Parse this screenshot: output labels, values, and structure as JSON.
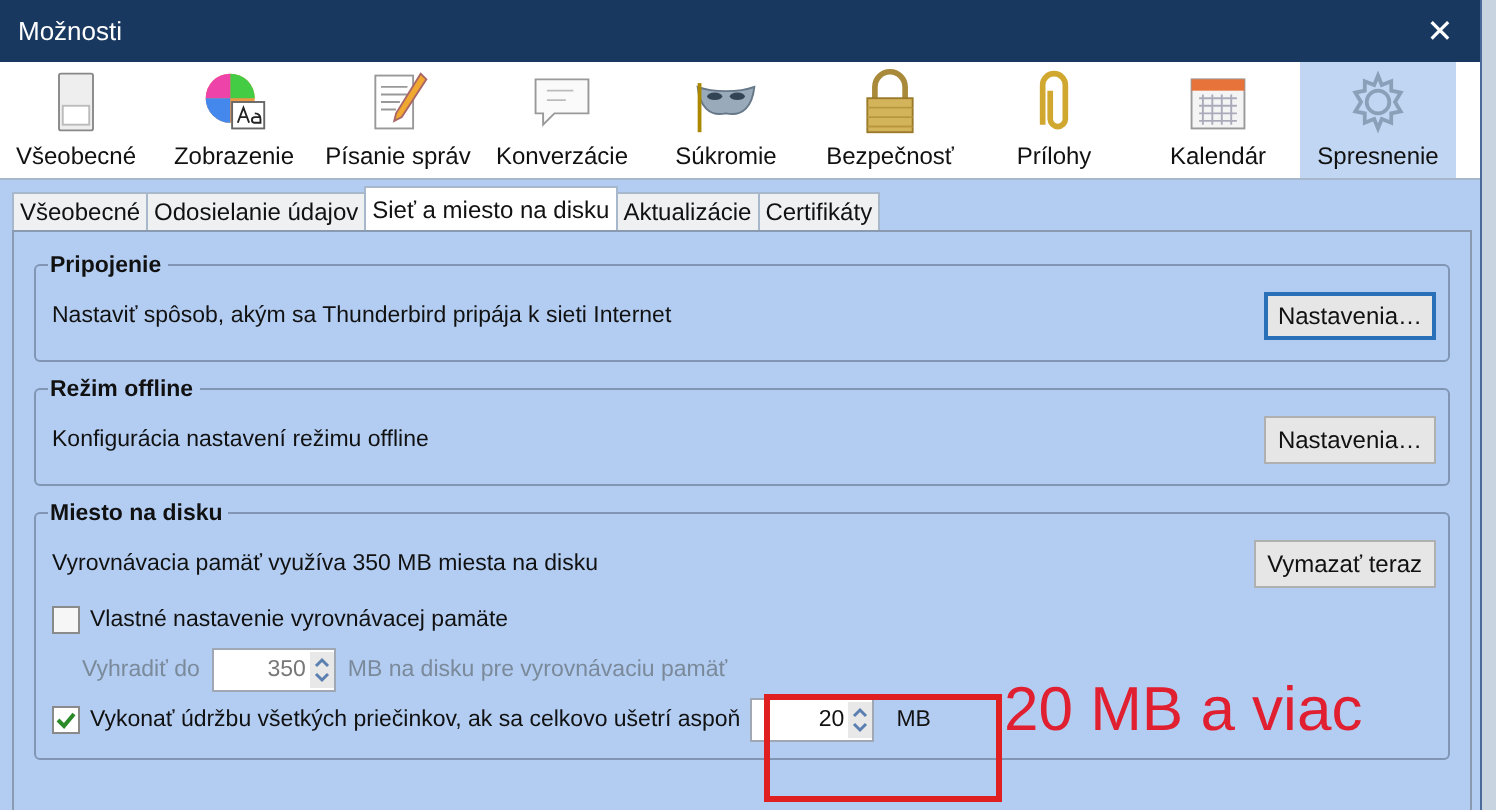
{
  "window": {
    "title": "Možnosti",
    "close": "✕"
  },
  "toolbar": [
    {
      "label": "Všeobecné",
      "kind": "switch",
      "selected": false
    },
    {
      "label": "Zobrazenie",
      "kind": "palette",
      "selected": false
    },
    {
      "label": "Písanie správ",
      "kind": "compose",
      "selected": false
    },
    {
      "label": "Konverzácie",
      "kind": "chat",
      "selected": false
    },
    {
      "label": "Súkromie",
      "kind": "mask",
      "selected": false
    },
    {
      "label": "Bezpečnosť",
      "kind": "lock",
      "selected": false
    },
    {
      "label": "Prílohy",
      "kind": "clip",
      "selected": false
    },
    {
      "label": "Kalendár",
      "kind": "calendar",
      "selected": false
    },
    {
      "label": "Spresnenie",
      "kind": "gear",
      "selected": true
    }
  ],
  "tabs": [
    {
      "label": "Všeobecné",
      "selected": false
    },
    {
      "label": "Odosielanie údajov",
      "selected": false
    },
    {
      "label": "Sieť a miesto na disku",
      "selected": true
    },
    {
      "label": "Aktualizácie",
      "selected": false
    },
    {
      "label": "Certifikáty",
      "selected": false
    }
  ],
  "groups": [
    {
      "title": "Pripojenie",
      "rows": [
        {
          "kind": "text_button",
          "text": "Nastaviť spôsob, akým sa Thunderbird pripája k sieti Internet",
          "button": "Nastavenia…",
          "focused": true
        }
      ]
    },
    {
      "title": "Režim offline",
      "rows": [
        {
          "kind": "text_button",
          "text": "Konfigurácia nastavení režimu offline",
          "button": "Nastavenia…",
          "focused": false
        }
      ]
    },
    {
      "title": "Miesto na disku",
      "rows": [
        {
          "kind": "text_button",
          "text": "Vyrovnávacia pamäť využíva 350 MB miesta na disku",
          "button": "Vymazať teraz",
          "focused": false
        },
        {
          "kind": "checkbox",
          "label": "Vlastné nastavenie vyrovnávacej pamäte",
          "checked": false
        },
        {
          "kind": "spinner",
          "label": "Vyhradiť do",
          "value": "350",
          "unit": "MB na disku pre vyrovnávaciu pamäť",
          "disabled": true
        },
        {
          "kind": "checkbox_spinner",
          "label": "Vykonať údržbu všetkých priečinkov, ak sa celkovo ušetrí aspoň",
          "checked": true,
          "value": "20",
          "unit": "MB"
        }
      ]
    }
  ],
  "annotation": {
    "text": "20 MB a viac"
  }
}
